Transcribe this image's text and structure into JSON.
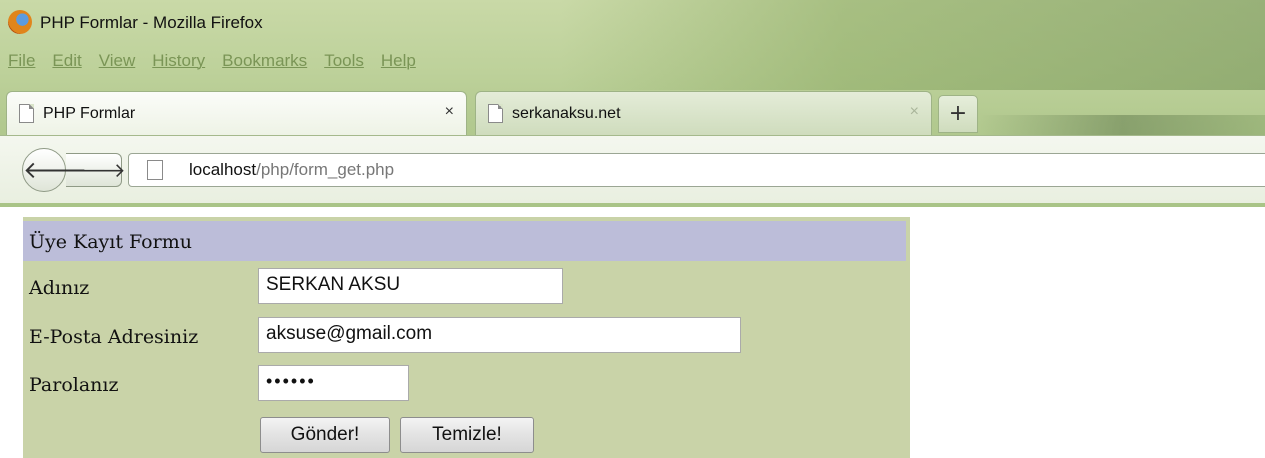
{
  "window": {
    "title": "PHP Formlar - Mozilla Firefox"
  },
  "menu": [
    "File",
    "Edit",
    "View",
    "History",
    "Bookmarks",
    "Tools",
    "Help"
  ],
  "tabs": [
    {
      "label": "PHP Formlar",
      "close": "×"
    },
    {
      "label": "serkanaksu.net",
      "close": "×"
    }
  ],
  "new_tab_label": "+",
  "nav": {
    "back": "🡐",
    "forward": "🡒"
  },
  "address": {
    "host": "localhost",
    "path": "/php/form_get.php"
  },
  "form": {
    "title": "Üye Kayıt Formu",
    "name_label": "Adınız",
    "name_value": "SERKAN AKSU",
    "email_label": "E-Posta Adresiniz",
    "email_value": "aksuse@gmail.com",
    "password_label": "Parolanız",
    "password_value": "••••••",
    "submit_label": "Gönder!",
    "reset_label": "Temizle!"
  },
  "colors": {
    "form_bg": "#c9d3a8",
    "form_header_bg": "#bcbdd9",
    "chrome_bg": "#bdd19a"
  }
}
